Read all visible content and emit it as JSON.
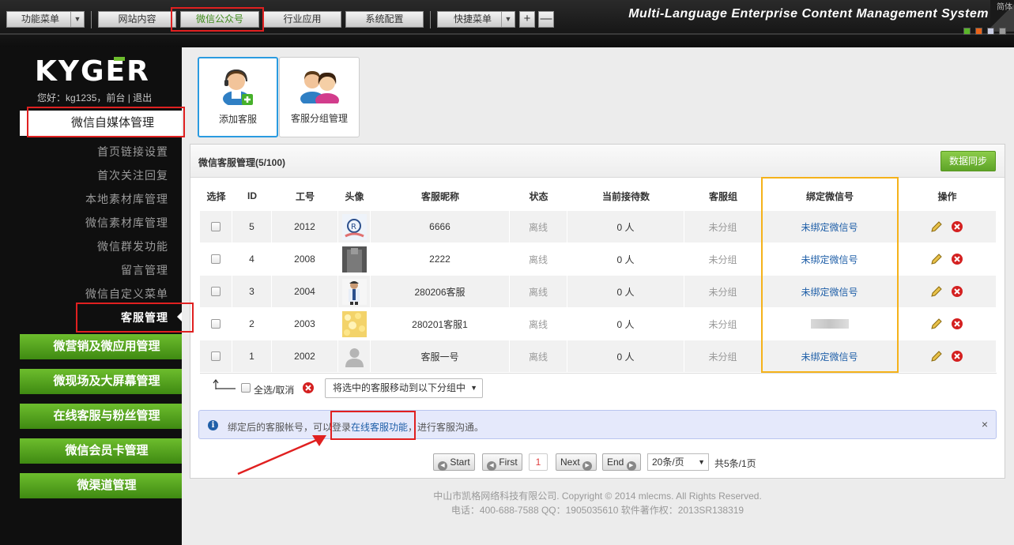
{
  "topbar": {
    "menus": [
      {
        "label": "功能菜单",
        "dropdown": true
      },
      {
        "label": "网站内容"
      },
      {
        "label": "微信公众号",
        "active": true
      },
      {
        "label": "行业应用"
      },
      {
        "label": "系统配置"
      },
      {
        "label": "快捷菜单",
        "dropdown": true
      }
    ],
    "plus": "+",
    "minus": "—",
    "brand_title": "Multi-Language Enterprise Content Management System",
    "brand_corner": "简体",
    "theme_colors": [
      "#5ab62a",
      "#e9641b",
      "#c9cde3",
      "#9a9a9a"
    ]
  },
  "sidebar": {
    "logo": "KYGER",
    "welcome": "您好：kg1235，前台 | 退出",
    "section_title": "微信自媒体管理",
    "sub_items": [
      "首页链接设置",
      "首次关注回复",
      "本地素材库管理",
      "微信素材库管理",
      "微信群发功能",
      "留言管理",
      "微信自定义菜单",
      "客服管理"
    ],
    "current_item": "客服管理",
    "green_menus": [
      "微营销及微应用管理",
      "微现场及大屏幕管理",
      "在线客服与粉丝管理",
      "微信会员卡管理",
      "微渠道管理"
    ]
  },
  "tiles": [
    {
      "label": "添加客服",
      "icon": "add-service-agent-icon",
      "selected": true
    },
    {
      "label": "客服分组管理",
      "icon": "agent-group-icon",
      "selected": false
    }
  ],
  "panel": {
    "title": "微信客服管理(5/100)",
    "sync_label": "数据同步",
    "columns": [
      "选择",
      "ID",
      "工号",
      "头像",
      "客服昵称",
      "状态",
      "当前接待数",
      "客服组",
      "绑定微信号",
      "操作"
    ],
    "rows": [
      {
        "id": "5",
        "job_no": "2012",
        "avatar": "registered-logo",
        "nickname": "6666",
        "status": "离线",
        "serving": "0 人",
        "group": "未分组",
        "bound": "未绑定微信号"
      },
      {
        "id": "4",
        "job_no": "2008",
        "avatar": "photo-dark",
        "nickname": "2222",
        "status": "离线",
        "serving": "0 人",
        "group": "未分组",
        "bound": "未绑定微信号"
      },
      {
        "id": "3",
        "job_no": "2004",
        "avatar": "photo-person",
        "nickname": "280206客服",
        "status": "离线",
        "serving": "0 人",
        "group": "未分组",
        "bound": "未绑定微信号"
      },
      {
        "id": "2",
        "job_no": "2003",
        "avatar": "photo-yellow",
        "nickname": "280201客服1",
        "status": "离线",
        "serving": "0 人",
        "group": "未分组",
        "bound": ""
      },
      {
        "id": "1",
        "job_no": "2002",
        "avatar": "default-user",
        "nickname": "客服一号",
        "status": "离线",
        "serving": "0 人",
        "group": "未分组",
        "bound": "未绑定微信号"
      }
    ],
    "select_all": "全选/取消",
    "move_select": "将选中的客服移动到以下分组中",
    "notice_prefix": "绑定后的客服帐号，可以登录",
    "notice_link": "在线客服功能",
    "notice_suffix": "，进行客服沟通。",
    "notice_close": "×",
    "pager": {
      "start": "Start",
      "first": "First",
      "current": "1",
      "next": "Next",
      "end": "End",
      "per_page": "20条/页",
      "summary": "共5条/1页"
    }
  },
  "footer": {
    "line1": "中山市凯格网络科技有限公司. Copyright © 2014 mlecms. All Rights Reserved.",
    "line2": "电话：400-688-7588  QQ：1905035610  软件著作权：2013SR138319"
  }
}
